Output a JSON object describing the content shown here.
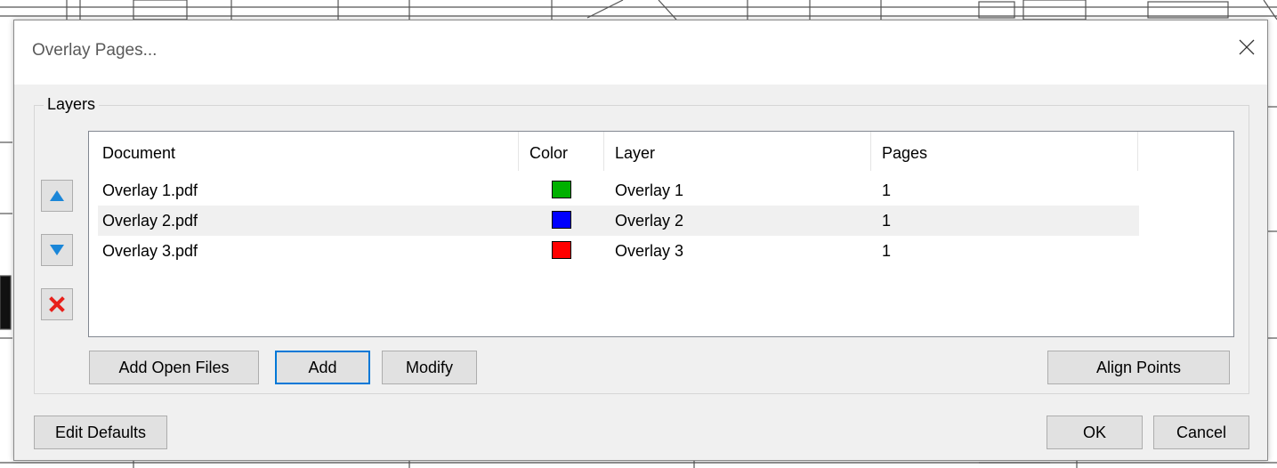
{
  "dialog": {
    "title": "Overlay Pages..."
  },
  "layers_group": {
    "label": "Layers",
    "columns": [
      "Document",
      "Color",
      "Layer",
      "Pages"
    ],
    "rows": [
      {
        "document": "Overlay 1.pdf",
        "color": "#00b000",
        "layer": "Overlay 1",
        "pages": "1"
      },
      {
        "document": "Overlay 2.pdf",
        "color": "#0000ff",
        "layer": "Overlay 2",
        "pages": "1"
      },
      {
        "document": "Overlay 3.pdf",
        "color": "#ff0000",
        "layer": "Overlay 3",
        "pages": "1"
      }
    ],
    "side_buttons": [
      {
        "name": "move-up",
        "icon": "triangle-up-icon",
        "color": "#1a86d8"
      },
      {
        "name": "move-down",
        "icon": "triangle-down-icon",
        "color": "#1a86d8"
      },
      {
        "name": "remove",
        "icon": "red-x-icon",
        "color": "#e8201b"
      }
    ],
    "buttons": {
      "add_open_files": "Add Open Files",
      "add": "Add",
      "modify": "Modify",
      "align_points": "Align Points"
    }
  },
  "footer": {
    "edit_defaults": "Edit Defaults",
    "ok": "OK",
    "cancel": "Cancel"
  }
}
